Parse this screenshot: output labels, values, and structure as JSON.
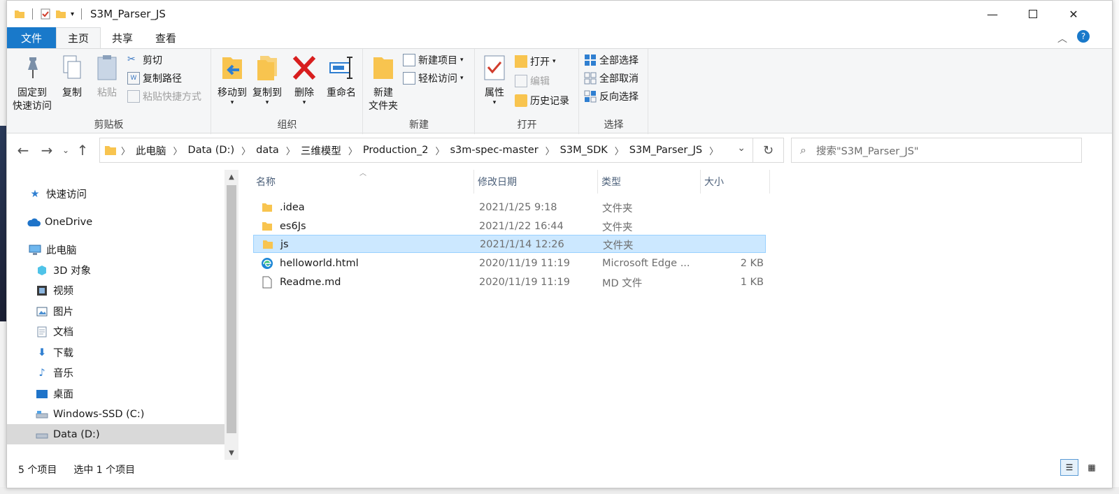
{
  "window": {
    "title": "S3M_Parser_JS"
  },
  "tabs": [
    {
      "label": "文件"
    },
    {
      "label": "主页"
    },
    {
      "label": "共享"
    },
    {
      "label": "查看"
    }
  ],
  "ribbon": {
    "clipboard": {
      "label": "剪贴板",
      "pin": "固定到\n快速访问",
      "copy": "复制",
      "paste": "粘贴",
      "cut": "剪切",
      "copy_path": "复制路径",
      "paste_shortcut": "粘贴快捷方式"
    },
    "organize": {
      "label": "组织",
      "move_to": "移动到",
      "copy_to": "复制到",
      "delete": "删除",
      "rename": "重命名"
    },
    "new": {
      "label": "新建",
      "new_folder": "新建\n文件夹",
      "new_item": "新建项目",
      "easy_access": "轻松访问"
    },
    "open": {
      "label": "打开",
      "properties": "属性",
      "open": "打开",
      "edit": "编辑",
      "history": "历史记录"
    },
    "select": {
      "label": "选择",
      "select_all": "全部选择",
      "select_none": "全部取消",
      "invert": "反向选择"
    }
  },
  "address": {
    "crumbs": [
      "此电脑",
      "Data (D:)",
      "data",
      "三维模型",
      "Production_2",
      "s3m-spec-master",
      "S3M_SDK",
      "S3M_Parser_JS"
    ],
    "search_placeholder": "搜索\"S3M_Parser_JS\""
  },
  "nav": [
    {
      "label": "快速访问",
      "icon": "star-icon"
    },
    {
      "label": "OneDrive",
      "icon": "cloud-icon"
    },
    {
      "label": "此电脑",
      "icon": "computer-icon"
    },
    {
      "label": "3D 对象",
      "icon": "cube-icon"
    },
    {
      "label": "视频",
      "icon": "video-icon"
    },
    {
      "label": "图片",
      "icon": "picture-icon"
    },
    {
      "label": "文档",
      "icon": "document-icon"
    },
    {
      "label": "下载",
      "icon": "download-icon"
    },
    {
      "label": "音乐",
      "icon": "music-icon"
    },
    {
      "label": "桌面",
      "icon": "desktop-icon"
    },
    {
      "label": "Windows-SSD (C:)",
      "icon": "drive-icon"
    },
    {
      "label": "Data (D:)",
      "icon": "drive-icon"
    }
  ],
  "columns": {
    "name": "名称",
    "date": "修改日期",
    "type": "类型",
    "size": "大小"
  },
  "files": [
    {
      "name": ".idea",
      "date": "2021/1/25 9:18",
      "type": "文件夹",
      "size": "",
      "icon": "folder-icon"
    },
    {
      "name": "es6Js",
      "date": "2021/1/22 16:44",
      "type": "文件夹",
      "size": "",
      "icon": "folder-icon"
    },
    {
      "name": "js",
      "date": "2021/1/14 12:26",
      "type": "文件夹",
      "size": "",
      "icon": "folder-icon"
    },
    {
      "name": "helloworld.html",
      "date": "2020/11/19 11:19",
      "type": "Microsoft Edge ...",
      "size": "2 KB",
      "icon": "edge-icon"
    },
    {
      "name": "Readme.md",
      "date": "2020/11/19 11:19",
      "type": "MD 文件",
      "size": "1 KB",
      "icon": "file-icon"
    }
  ],
  "status": {
    "count": "5 个项目",
    "selected": "选中 1 个项目"
  },
  "colors": {
    "accent": "#1979ca",
    "selection": "#cce8ff",
    "folder": "#f8c44f"
  }
}
